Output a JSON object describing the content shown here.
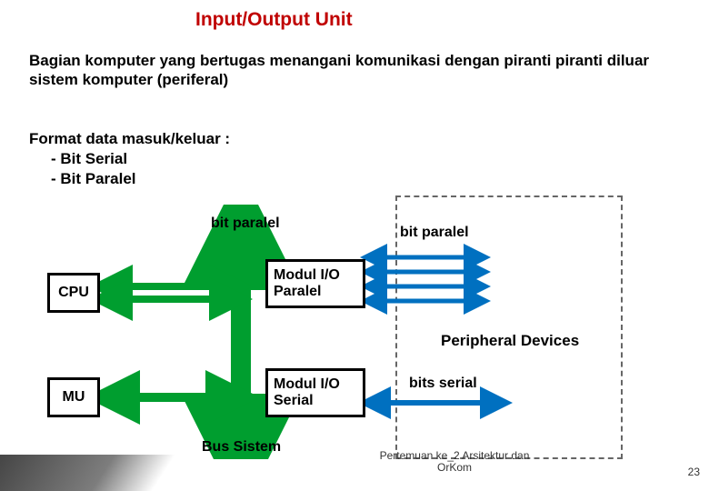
{
  "title": "Input/Output Unit",
  "paragraph": "Bagian komputer yang bertugas menangani komunikasi dengan piranti piranti diluar sistem komputer (periferal)",
  "format": {
    "heading": "Format data masuk/keluar :",
    "items": [
      "-  Bit Serial",
      "-  Bit Paralel"
    ]
  },
  "diagram": {
    "cpu": "CPU",
    "mu": "MU",
    "modul_paralel": "Modul I/O Paralel",
    "modul_serial": "Modul I/O Serial",
    "bit_paralel_top": "bit paralel",
    "bit_paralel_right": "bit paralel",
    "peripheral": "Peripheral Devices",
    "bits_serial": "bits serial",
    "bus": "Bus Sistem"
  },
  "footer": "Pertemuan ke_2 Arsitektur dan OrKom",
  "page": "23",
  "colors": {
    "title": "#c00000",
    "arrow_green": "#009e2f",
    "arrow_blue": "#0070c0"
  }
}
